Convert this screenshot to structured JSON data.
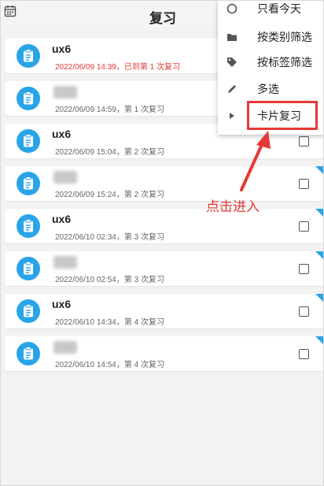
{
  "header": {
    "title": "复习"
  },
  "rows": [
    {
      "name": "ux6",
      "name_hidden": false,
      "subtitle": "2022/06/09 14:39，已到第 1 次复习",
      "subtitle_red": true
    },
    {
      "name": "",
      "name_hidden": true,
      "subtitle": "2022/06/09 14:59，第 1 次复习",
      "subtitle_red": false
    },
    {
      "name": "ux6",
      "name_hidden": false,
      "subtitle": "2022/06/09 15:04，第 2 次复习",
      "subtitle_red": false
    },
    {
      "name": "",
      "name_hidden": true,
      "subtitle": "2022/06/09 15:24，第 2 次复习",
      "subtitle_red": false
    },
    {
      "name": "ux6",
      "name_hidden": false,
      "subtitle": "2022/06/10 02:34，第 3 次复习",
      "subtitle_red": false
    },
    {
      "name": "",
      "name_hidden": true,
      "subtitle": "2022/06/10 02:54，第 3 次复习",
      "subtitle_red": false
    },
    {
      "name": "ux6",
      "name_hidden": false,
      "subtitle": "2022/06/10 14:34，第 4 次复习",
      "subtitle_red": false
    },
    {
      "name": "",
      "name_hidden": true,
      "subtitle": "2022/06/10 14:54，第 4 次复习",
      "subtitle_red": false
    }
  ],
  "menu": {
    "items": [
      {
        "label": "只看今天",
        "icon": "circle-icon"
      },
      {
        "label": "按类别筛选",
        "icon": "folder-icon"
      },
      {
        "label": "按标签筛选",
        "icon": "tag-icon"
      },
      {
        "label": "多选",
        "icon": "pencil-icon"
      },
      {
        "label": "卡片复习",
        "icon": "play-arrow-icon"
      }
    ]
  },
  "annotation": {
    "text": "点击进入"
  },
  "colors": {
    "accent": "#2aa4e8",
    "red": "#e53935",
    "subtitle_red": "#e23a3a"
  }
}
